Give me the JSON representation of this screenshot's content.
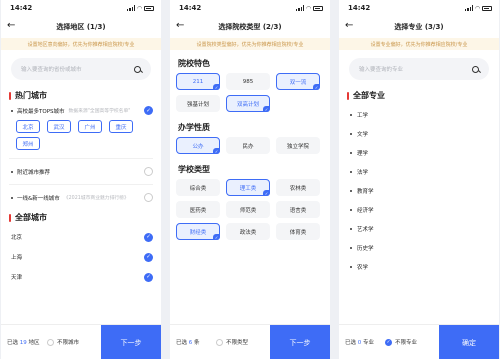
{
  "status": {
    "time": "14:42"
  },
  "p1": {
    "title": "选择地区 (1/3)",
    "notice": "设置地区意向偏好，优先为你推荐相应院校/专业",
    "search_placeholder": "输入要查询的省份或城市",
    "hot_title": "热门城市",
    "top_row": {
      "label": "高校最多TOPS城市",
      "note": "数据来源\"全国高等学校名单\""
    },
    "top_chips": [
      "北京",
      "武汉",
      "广州",
      "重庆",
      "郑州"
    ],
    "rows": [
      {
        "label": "附近城市推荐",
        "note": ""
      },
      {
        "label": "一线&新一线城市",
        "note": "《2021城市商业魅力排行榜》"
      }
    ],
    "all_title": "全部城市",
    "cities": [
      "北京",
      "上海",
      "天津"
    ],
    "bottom": {
      "prefix": "已选",
      "count": "19",
      "suffix": "地区",
      "nolimit": "不限城市",
      "button": "下一步"
    }
  },
  "p2": {
    "title": "选择院校类型 (2/3)",
    "notice": "设置院校类型偏好，优先为你推荐相应院校/专业",
    "sections": [
      {
        "title": "院校特色",
        "items": [
          {
            "label": "211",
            "selected": true
          },
          {
            "label": "985",
            "selected": false
          },
          {
            "label": "双一流",
            "selected": true
          },
          {
            "label": "强基计划",
            "selected": false
          },
          {
            "label": "双高计划",
            "selected": true
          }
        ]
      },
      {
        "title": "办学性质",
        "items": [
          {
            "label": "公办",
            "selected": true
          },
          {
            "label": "民办",
            "selected": false
          },
          {
            "label": "独立学院",
            "selected": false
          }
        ]
      },
      {
        "title": "学校类型",
        "items": [
          {
            "label": "综合类",
            "selected": false
          },
          {
            "label": "理工类",
            "selected": true
          },
          {
            "label": "农林类",
            "selected": false
          },
          {
            "label": "医药类",
            "selected": false
          },
          {
            "label": "师范类",
            "selected": false
          },
          {
            "label": "语言类",
            "selected": false
          },
          {
            "label": "财经类",
            "selected": true
          },
          {
            "label": "政法类",
            "selected": false
          },
          {
            "label": "体育类",
            "selected": false
          }
        ]
      }
    ],
    "bottom": {
      "prefix": "已选",
      "count": "6",
      "suffix": "条",
      "nolimit": "不限类型",
      "button": "下一步"
    }
  },
  "p3": {
    "title": "选择专业 (3/3)",
    "notice": "设置专业偏好，优先为你推荐相应院校/专业",
    "search_placeholder": "输入要查询的专业",
    "all_title": "全部专业",
    "majors": [
      "工学",
      "文学",
      "理学",
      "法学",
      "教育学",
      "经济学",
      "艺术学",
      "历史学",
      "农学"
    ],
    "bottom": {
      "prefix": "已选",
      "count": "0",
      "suffix": "专业",
      "nolimit": "不限专业",
      "button": "确定"
    }
  },
  "colors": {
    "accent": "#3e6cf6",
    "hot_bar": "#e53935",
    "notice_bg": "#fdf6e7"
  }
}
